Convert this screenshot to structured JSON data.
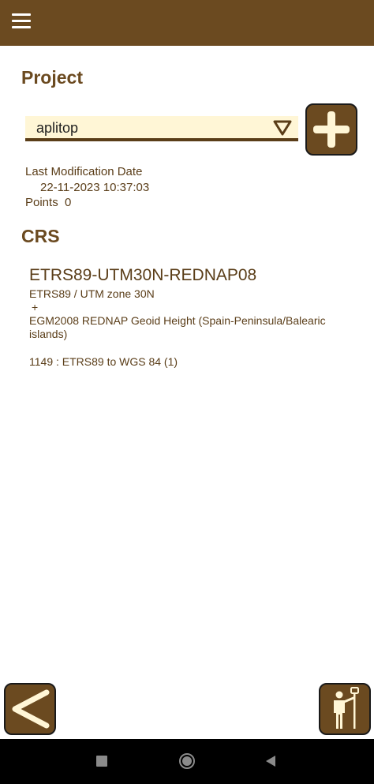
{
  "app_bar": {
    "menu_icon": "hamburger-menu-icon"
  },
  "project": {
    "title": "Project",
    "selected": "aplitop",
    "last_mod_label": "Last Modification Date",
    "last_mod_value": "22-11-2023 10:37:03",
    "points_label": "Points",
    "points_value": "0"
  },
  "crs": {
    "title": "CRS",
    "name": "ETRS89-UTM30N-REDNAP08",
    "projection": "ETRS89 / UTM zone 30N",
    "plus": "+",
    "geoid": "EGM2008 REDNAP Geoid Height (Spain-Peninsula/Balearic islands)",
    "transform": "1149 : ETRS89 to WGS 84 (1)"
  },
  "buttons": {
    "add_icon": "plus-icon",
    "back_icon": "chevron-left-icon",
    "surveyor_icon": "surveyor-pole-icon"
  },
  "colors": {
    "brand": "#6b4a20",
    "dropdown_bg": "#fff6d6",
    "icon_fill": "#fff6d6"
  }
}
